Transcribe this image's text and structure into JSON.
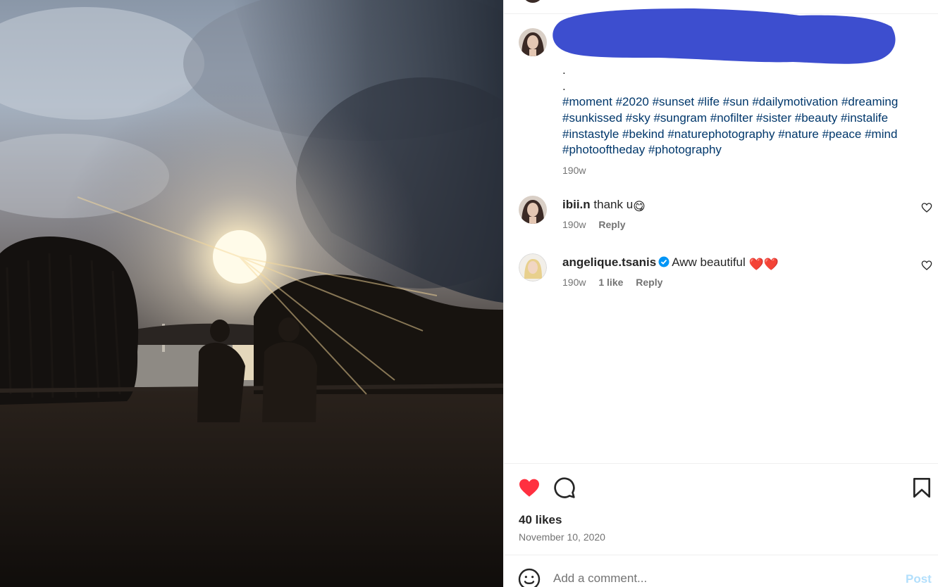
{
  "post": {
    "caption_dots": [
      ".",
      "."
    ],
    "hashtags": "#moment #2020 #sunset #life #sun #dailymotivation #dreaming #sunkissed #sky #sungram #nofilter #sister #beauty #instalife #instastyle #bekind #naturephotography #nature #peace #mind #photooftheday #photography",
    "caption_time": "190w"
  },
  "comments": [
    {
      "username": "ibii.n",
      "text": "thank u",
      "emoji": "😋",
      "time": "190w",
      "likes": "",
      "reply": "Reply"
    },
    {
      "username": "angelique.tsanis",
      "verified": true,
      "text": "Aww beautiful",
      "emoji": "❤️❤️",
      "time": "190w",
      "likes": "1 like",
      "reply": "Reply"
    }
  ],
  "actions": {
    "like_icon": "heart-filled-icon",
    "comment_icon": "comment-bubble-icon",
    "save_icon": "bookmark-icon",
    "like_color": "#ff3040"
  },
  "likes_count": "40 likes",
  "date": "November 10, 2020",
  "add_comment": {
    "placeholder": "Add a comment...",
    "post_label": "Post"
  },
  "colors": {
    "hashtag": "#00376b",
    "secondary_text": "#737373",
    "redaction": "#3d4ecf",
    "post_disabled": "#b2dffc"
  }
}
